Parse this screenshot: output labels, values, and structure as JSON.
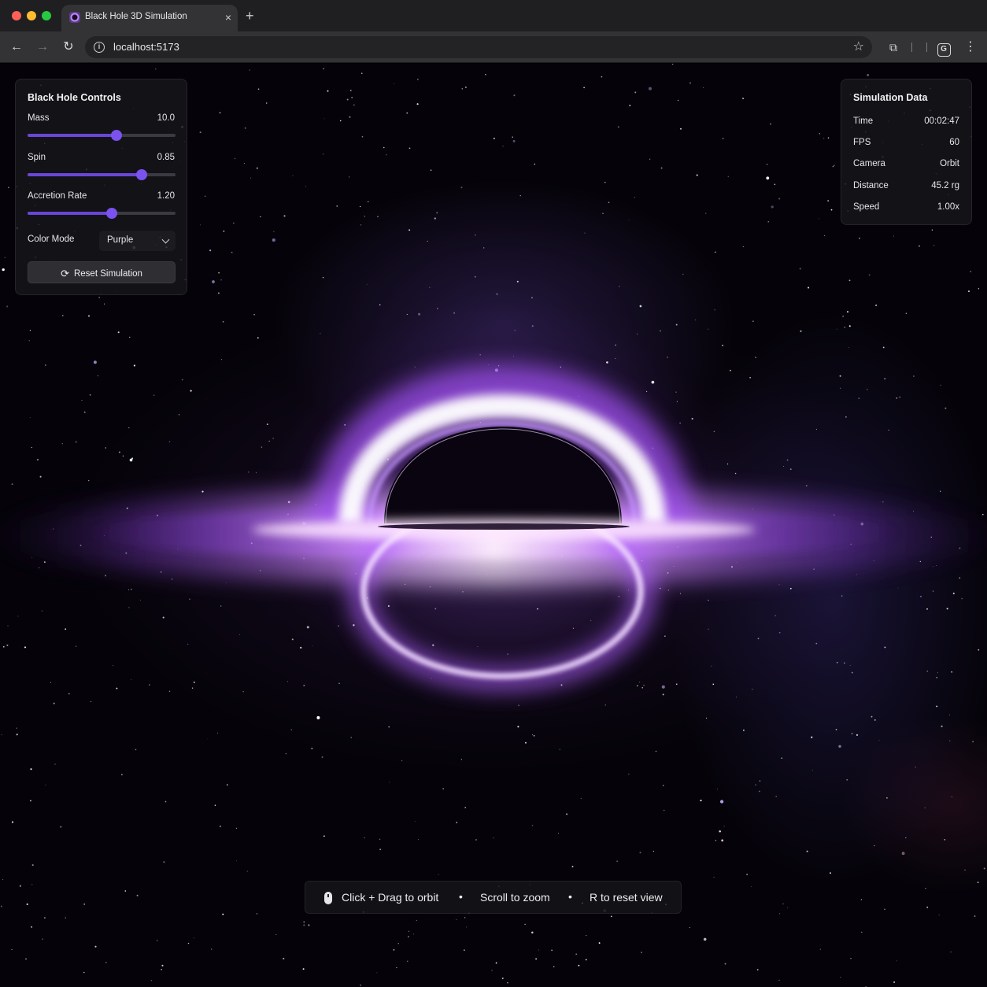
{
  "browser": {
    "tab_title": "Black Hole 3D Simulation",
    "tab_close": "×",
    "new_tab": "+",
    "url": "localhost:5173",
    "profile_letter": "G"
  },
  "controls": {
    "title": "Black Hole Controls",
    "mass": {
      "label": "Mass",
      "value": "10.0",
      "fraction": 0.6
    },
    "spin": {
      "label": "Spin",
      "value": "0.85",
      "fraction": 0.77
    },
    "accretion": {
      "label": "Accretion Rate",
      "value": "1.20",
      "fraction": 0.57
    },
    "color_mode": {
      "label": "Color Mode",
      "selected": "Purple"
    },
    "reset_label": "Reset Simulation"
  },
  "sim_data": {
    "title": "Simulation Data",
    "rows": [
      {
        "label": "Time",
        "value": "00:02:47"
      },
      {
        "label": "FPS",
        "value": "60"
      },
      {
        "label": "Camera",
        "value": "Orbit"
      },
      {
        "label": "Distance",
        "value": "45.2 rg"
      },
      {
        "label": "Speed",
        "value": "1.00x"
      }
    ]
  },
  "hints": {
    "orbit": "Click + Drag to orbit",
    "zoom": "Scroll to zoom",
    "reset": "R  to reset view",
    "separator": "•"
  },
  "colors": {
    "accent": "#7a52f0",
    "disk": "#c77dff",
    "disk_core": "#ffffff"
  }
}
